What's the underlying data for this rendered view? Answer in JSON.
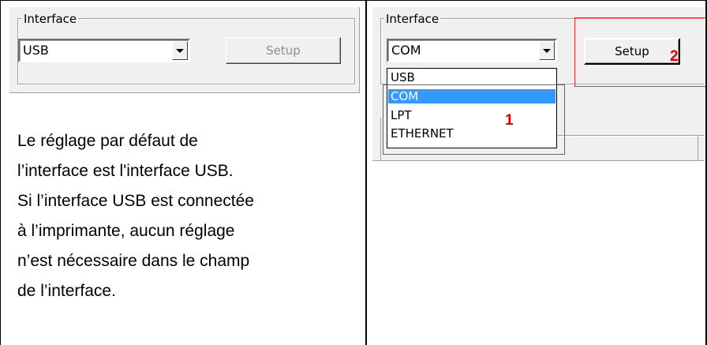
{
  "left_panel": {
    "group_label": "Interface",
    "combo_value": "USB",
    "setup_label": "Setup",
    "description_lines": [
      "Le réglage par défaut de",
      "l’interface est l'interface USB.",
      "Si l’interface USB est connectée",
      "à l’imprimante, aucun réglage",
      "n’est nécessaire dans le champ",
      "de l’interface."
    ]
  },
  "right_panel": {
    "group_label": "Interface",
    "combo_value": "COM",
    "setup_label": "Setup",
    "dropdown_options": [
      "USB",
      "COM",
      "LPT",
      "ETHERNET"
    ],
    "selected_option": "COM",
    "callout_1": "1",
    "callout_2": "2"
  },
  "colors": {
    "window_bg": "#f0f0f0",
    "selection": "#3399ff",
    "callout_red": "#e23131"
  }
}
